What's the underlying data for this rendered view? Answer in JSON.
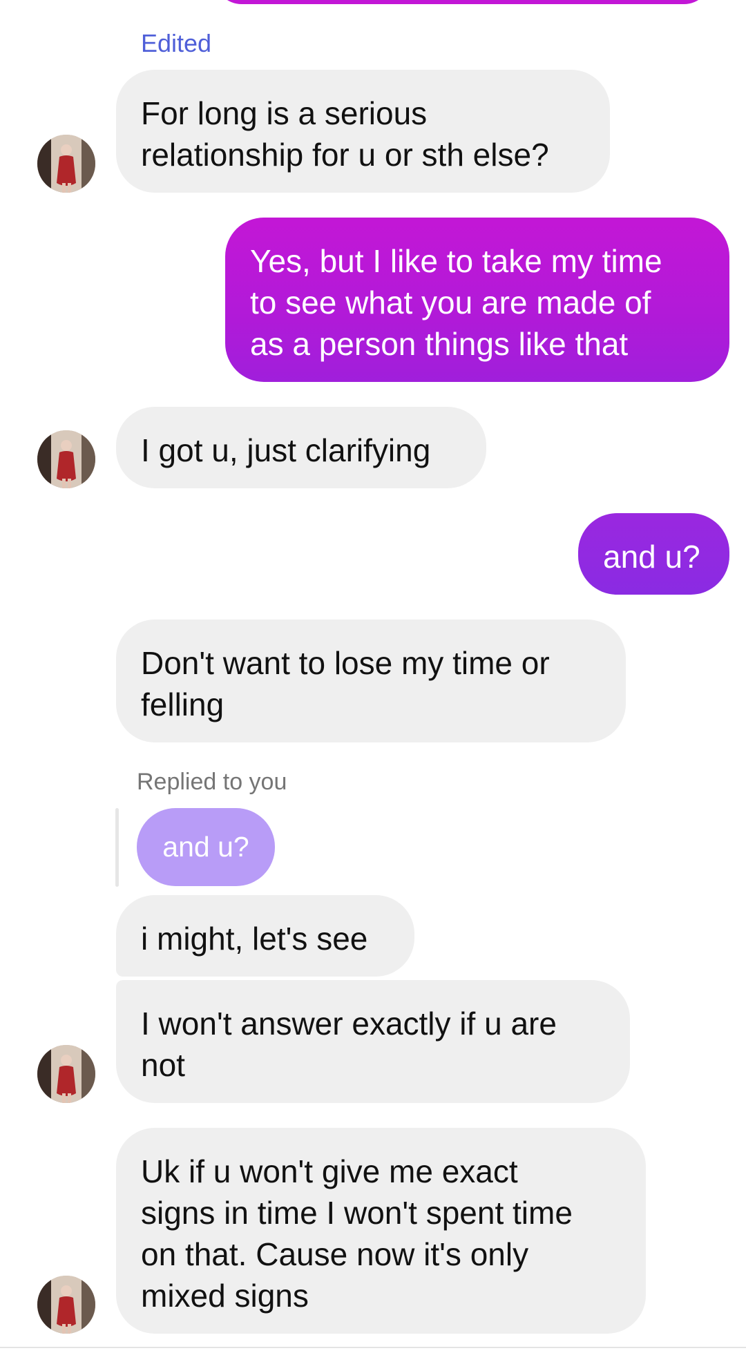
{
  "colors": {
    "incoming_bg": "#efefef",
    "outgoing_top": "#c317d6",
    "outgoing_bottom": "#8a2be2",
    "reply_preview_bg": "#b89cf7",
    "edited_label": "#4f5fd8",
    "meta_text": "#757575"
  },
  "thread": {
    "edited_label": "Edited",
    "replied_label": "Replied to you",
    "reply_preview": "and u?",
    "messages": [
      {
        "from": "them",
        "text": "For long is a serious\nrelationship for u or sth else?"
      },
      {
        "from": "me",
        "text": "Yes, but I like to take my time\nto see what you are made of\nas a person things like that"
      },
      {
        "from": "them",
        "text": "I got u, just clarifying"
      },
      {
        "from": "me",
        "text": "and u?"
      },
      {
        "from": "them",
        "text": "Don't want to lose my time or\nfelling"
      },
      {
        "from": "them",
        "text": "i might, let's see"
      },
      {
        "from": "them",
        "text": "I won't answer exactly if u are\nnot"
      },
      {
        "from": "them",
        "text": "Uk if u won't give me exact\nsigns in time I won't spent time\non that. Cause now it's only\nmixed signs"
      }
    ]
  },
  "avatar_icon": "contact-photo"
}
